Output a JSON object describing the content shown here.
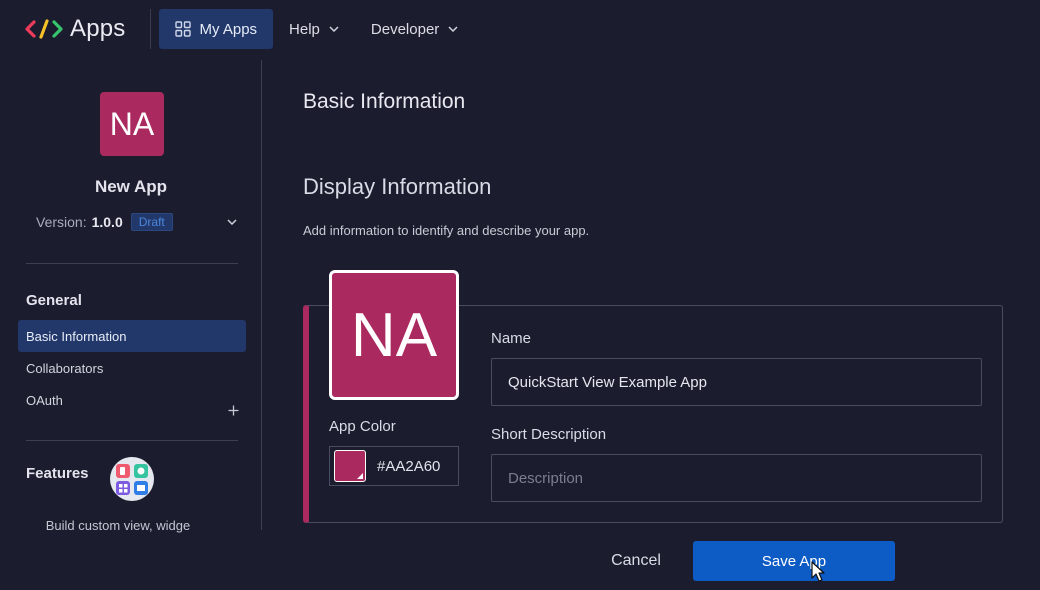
{
  "topbar": {
    "brand": "Apps",
    "nav": [
      {
        "label": "My Apps",
        "icon": "grid-icon",
        "active": true
      },
      {
        "label": "Help",
        "icon": "chevron-down-icon"
      },
      {
        "label": "Developer",
        "icon": "chevron-down-icon"
      }
    ]
  },
  "sidebar": {
    "app_initials": "NA",
    "app_name": "New App",
    "version_label": "Version:",
    "version_value": "1.0.0",
    "status_badge": "Draft",
    "general_title": "General",
    "general_items": [
      {
        "label": "Basic Information",
        "active": true
      },
      {
        "label": "Collaborators"
      },
      {
        "label": "OAuth"
      }
    ],
    "features_title": "Features",
    "features_text": "Build custom view, widge"
  },
  "main": {
    "title": "Basic Information",
    "section_title": "Display Information",
    "section_desc": "Add information to identify and describe your app.",
    "avatar_initials": "NA",
    "app_color_label": "App Color",
    "app_color_value": "#AA2A60",
    "name_label": "Name",
    "name_value": "QuickStart View Example App",
    "short_desc_label": "Short Description",
    "short_desc_placeholder": "Description"
  },
  "footer": {
    "cancel_label": "Cancel",
    "save_label": "Save App"
  },
  "colors": {
    "background": "#1b1d2e",
    "app_color": "#aa2a60",
    "primary_button": "#0d5bc4",
    "active_nav": "#22386a"
  }
}
